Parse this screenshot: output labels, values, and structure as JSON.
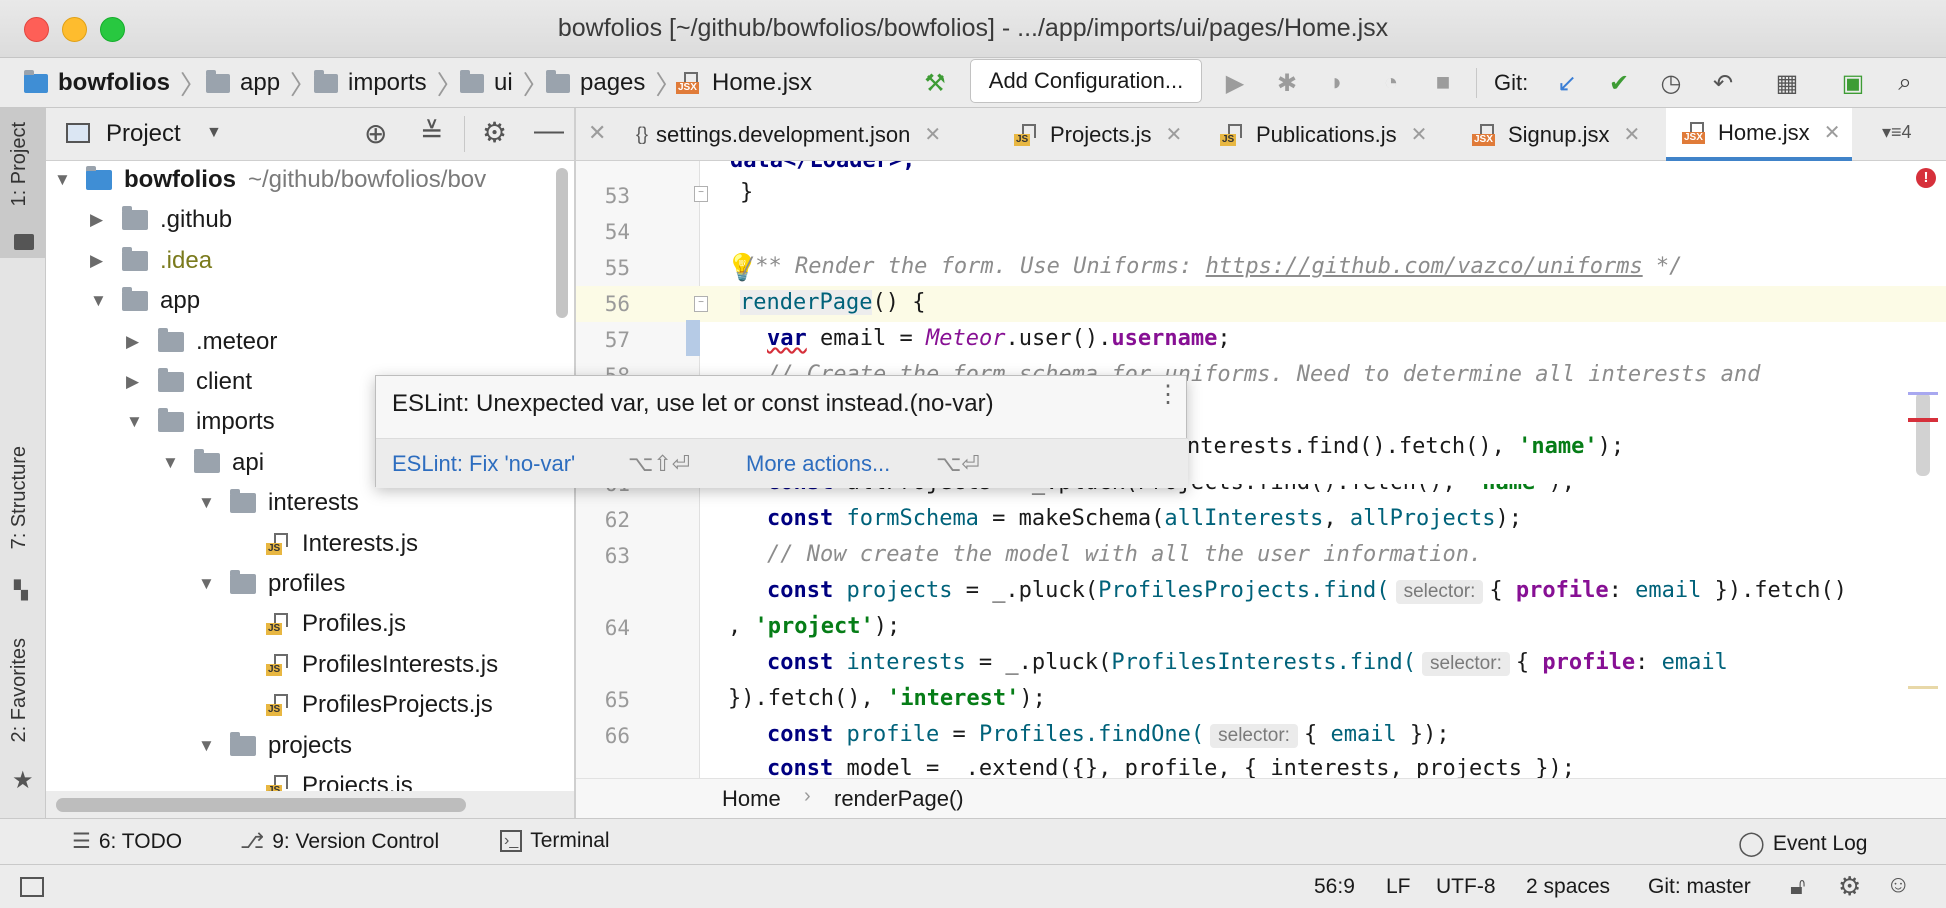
{
  "window": {
    "title": "bowfolios [~/github/bowfolios/bowfolios] - .../app/imports/ui/pages/Home.jsx"
  },
  "navbar": {
    "crumbs": [
      "bowfolios",
      "app",
      "imports",
      "ui",
      "pages",
      "Home.jsx"
    ],
    "add_configuration": "Add Configuration...",
    "git_label": "Git:"
  },
  "left_strip": {
    "project": "1: Project",
    "structure": "7: Structure",
    "favorites": "2: Favorites"
  },
  "project_panel": {
    "title": "Project",
    "tree": [
      {
        "label": "bowfolios",
        "suffix": "~/github/bowfolios/bov",
        "depth": 0,
        "expanded": true,
        "kind": "module"
      },
      {
        "label": ".github",
        "depth": 1,
        "expanded": false,
        "kind": "folder"
      },
      {
        "label": ".idea",
        "depth": 1,
        "expanded": false,
        "kind": "folder-olive"
      },
      {
        "label": "app",
        "depth": 1,
        "expanded": true,
        "kind": "folder"
      },
      {
        "label": ".meteor",
        "depth": 2,
        "expanded": false,
        "kind": "folder"
      },
      {
        "label": "client",
        "depth": 2,
        "expanded": false,
        "kind": "folder"
      },
      {
        "label": "imports",
        "depth": 2,
        "expanded": true,
        "kind": "folder"
      },
      {
        "label": "api",
        "depth": 3,
        "expanded": true,
        "kind": "folder"
      },
      {
        "label": "interests",
        "depth": 4,
        "expanded": true,
        "kind": "folder"
      },
      {
        "label": "Interests.js",
        "depth": 5,
        "kind": "js"
      },
      {
        "label": "profiles",
        "depth": 4,
        "expanded": true,
        "kind": "folder"
      },
      {
        "label": "Profiles.js",
        "depth": 5,
        "kind": "js"
      },
      {
        "label": "ProfilesInterests.js",
        "depth": 5,
        "kind": "js"
      },
      {
        "label": "ProfilesProjects.js",
        "depth": 5,
        "kind": "js"
      },
      {
        "label": "projects",
        "depth": 4,
        "expanded": true,
        "kind": "folder"
      },
      {
        "label": "Projects.js",
        "depth": 5,
        "kind": "js"
      }
    ]
  },
  "tabs": [
    {
      "label": "settings.development.json",
      "kind": "json"
    },
    {
      "label": "Projects.js",
      "kind": "js"
    },
    {
      "label": "Publications.js",
      "kind": "js"
    },
    {
      "label": "Signup.jsx",
      "kind": "jsx"
    },
    {
      "label": "Home.jsx",
      "kind": "jsx",
      "active": true
    }
  ],
  "tab_overflow": "4",
  "editor": {
    "line_numbers": [
      "53",
      "54",
      "55",
      "56",
      "57",
      "58",
      "59",
      "60",
      "61",
      "62",
      "63",
      "",
      "64",
      "",
      "65",
      "66"
    ],
    "partial_top": "data</Loader>;",
    "line53": "}",
    "line55_comment": "/** Render the form. Use Uniforms: ",
    "line55_link": "https://github.com/vazco/uniforms",
    "line55_end": " */",
    "line56_fn": "renderPage",
    "line56_rest": "() {",
    "line57_kw": "var",
    "line57_a": " email = ",
    "line57_meteor": "Meteor",
    "line57_b": ".user().",
    "line57_prop": "username",
    "line57_c": ";",
    "line58_comment": "// Create the form schema for uniforms. Need to determine all interests and",
    "line59_a": "nterests.find().fetch(), ",
    "line59_str": "'name'",
    "line59_b": ");",
    "line60_kw": "const",
    "line60_a": " allProjects = _.pluck(Projects.find().fetch(), ",
    "line60_str": "'name'",
    "line60_b": ");",
    "line61_kw": "const",
    "line61_var": " formSchema",
    "line61_a": " = makeSchema(",
    "line61_v1": "allInterests",
    "line61_c": ", ",
    "line61_v2": "allProjects",
    "line61_b": ");",
    "line62_comment": "// Now create the model with all the user information.",
    "line63_kw": "const",
    "line63_var": " projects",
    "line63_a": " = _.pluck(",
    "line63_cls": "ProfilesProjects",
    "line63_b": ".find(",
    "line63_hint": "selector:",
    "line63_c": "{ ",
    "line63_prop": "profile",
    "line63_d": ": ",
    "line63_v": "email",
    "line63_e": " }).fetch()",
    "line63w_a": ", ",
    "line63w_str": "'project'",
    "line63w_b": ");",
    "line64_kw": "const",
    "line64_var": " interests",
    "line64_a": " = _.pluck(",
    "line64_cls": "ProfilesInterests",
    "line64_b": ".find(",
    "line64_hint": "selector:",
    "line64_c": "{ ",
    "line64_prop": "profile",
    "line64_d": ": ",
    "line64_v": "email",
    "line64w_a": "}).fetch(), ",
    "line64w_str": "'interest'",
    "line64w_b": ");",
    "line65_kw": "const",
    "line65_var": " profile",
    "line65_a": " = ",
    "line65_cls": "Profiles",
    "line65_b": ".findOne(",
    "line65_hint": "selector:",
    "line65_c": "{ ",
    "line65_v": "email",
    "line65_d": " });",
    "line66_kw": "const",
    "line66_a": " model = _.extend({}, profile, { interests, projects });"
  },
  "popup": {
    "message": "ESLint: Unexpected var, use let or const instead.(no-var)",
    "fix_label": "ESLint: Fix 'no-var'",
    "fix_shortcut": "⌥⇧⏎",
    "more_label": "More actions...",
    "more_shortcut": "⌥⏎"
  },
  "breadcrumb": {
    "items": [
      "Home",
      "renderPage()"
    ]
  },
  "tool_windows": {
    "todo": "6: TODO",
    "vcs": "9: Version Control",
    "terminal": "Terminal",
    "event_log": "Event Log"
  },
  "status": {
    "position": "56:9",
    "line_sep": "LF",
    "encoding": "UTF-8",
    "indent": "2 spaces",
    "git": "Git: master"
  },
  "colors": {
    "accent": "#4083c9",
    "current_line": "#fcfbe6",
    "popup_bg": "#f7f7f7",
    "error": "#d6303b"
  }
}
